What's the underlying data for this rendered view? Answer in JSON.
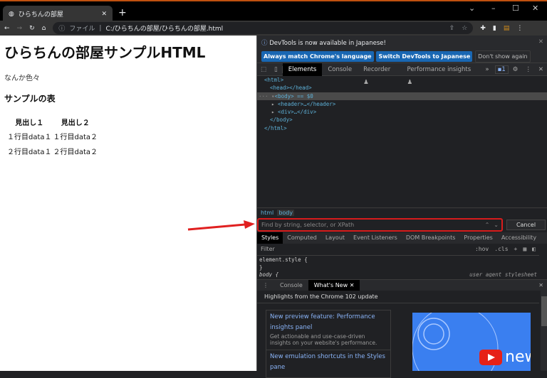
{
  "browser": {
    "tab_title": "ひらちんの部屋",
    "url_label": "ファイル",
    "url": "C:/ひらちんの部屋/ひらちんの部屋.html"
  },
  "page": {
    "heading": "ひらちんの部屋サンプルHTML",
    "paragraph": "なんか色々",
    "subheading": "サンプルの表",
    "table": {
      "headers": [
        "見出し１",
        "見出し２"
      ],
      "rows": [
        [
          "１行目data１",
          "１行目data２"
        ],
        [
          "２行目data１",
          "２行目data２"
        ]
      ]
    }
  },
  "devtools": {
    "info": {
      "message": "DevTools is now available in Japanese!",
      "btn_match": "Always match Chrome's language",
      "btn_switch": "Switch DevTools to Japanese",
      "btn_dismiss": "Don't show again"
    },
    "tabs": [
      "Elements",
      "Console",
      "Recorder ♟",
      "Performance insights ♟"
    ],
    "issues_count": "1",
    "tree": [
      "<html>",
      "<head></head>",
      "<body> == $0",
      "<header>…</header>",
      "<div>…</div>",
      "</body>",
      "</html>"
    ],
    "breadcrumbs": [
      "html",
      "body"
    ],
    "search": {
      "placeholder": "Find by string, selector, or XPath",
      "cancel": "Cancel"
    },
    "style_tabs": [
      "Styles",
      "Computed",
      "Layout",
      "Event Listeners",
      "DOM Breakpoints",
      "Properties",
      "Accessibility"
    ],
    "filter": {
      "placeholder": "Filter",
      "hov": ":hov",
      "cls": ".cls"
    },
    "styles": {
      "line1": "element.style {",
      "line2": "}",
      "line3": "body {",
      "source": "user agent stylesheet"
    },
    "drawer": {
      "tabs": [
        "Console",
        "What's New"
      ],
      "highlights": "Highlights from the Chrome 102 update",
      "cards": [
        {
          "title": "New preview feature: Performance insights panel",
          "desc": "Get actionable and use-case-driven insights on your website's performance."
        },
        {
          "title": "New emulation shortcuts in the Styles pane",
          "desc": ""
        }
      ],
      "video_text": "new"
    }
  }
}
